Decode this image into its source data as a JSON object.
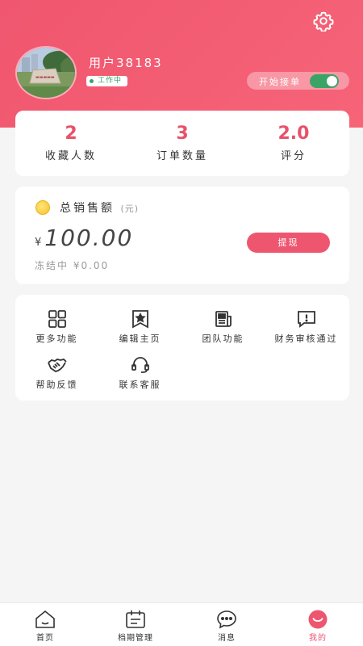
{
  "header": {
    "username": "用户38183",
    "status": "工作中",
    "order_toggle_label": "开始接单",
    "order_toggle_on": true
  },
  "stats": [
    {
      "value": "2",
      "label": "收藏人数"
    },
    {
      "value": "3",
      "label": "订单数量"
    },
    {
      "value": "2.0",
      "label": "评分"
    }
  ],
  "sales": {
    "title": "总销售额",
    "unit": "(元)",
    "currency": "¥",
    "amount": "100.00",
    "frozen": "冻结中 ¥0.00",
    "withdraw_label": "提现"
  },
  "menu": [
    {
      "label": "更多功能",
      "icon": "grid-icon"
    },
    {
      "label": "编辑主页",
      "icon": "star-bookmark-icon"
    },
    {
      "label": "团队功能",
      "icon": "document-icon"
    },
    {
      "label": "财务审核通过",
      "icon": "alert-message-icon"
    },
    {
      "label": "帮助反馈",
      "icon": "handshake-icon"
    },
    {
      "label": "联系客服",
      "icon": "headset-icon"
    }
  ],
  "tabs": [
    {
      "label": "首页",
      "icon": "home-icon"
    },
    {
      "label": "档期管理",
      "icon": "calendar-icon"
    },
    {
      "label": "消息",
      "icon": "chat-icon"
    },
    {
      "label": "我的",
      "icon": "profile-smile-icon",
      "active": true
    }
  ],
  "colors": {
    "brand": "#ee5670",
    "status_green": "#3aa466",
    "coin": "#f5c22c"
  }
}
